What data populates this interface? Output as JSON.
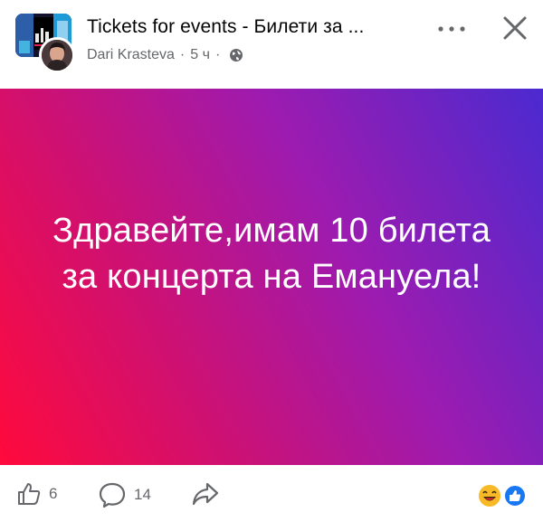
{
  "header": {
    "title": "Tickets for events - Билети за ...",
    "author": "Dari Krasteva",
    "separator": "·",
    "time": "5 ч",
    "privacy_icon": "globe-icon",
    "more_icon": "more-horizontal-icon",
    "close_icon": "close-icon"
  },
  "post": {
    "background": {
      "from": "#ff0a3c",
      "to": "#4b2ad0"
    },
    "text": "Здравейте,имам 10 билета за концерта на Емануела!"
  },
  "footer": {
    "like_icon": "thumbs-up-icon",
    "like_count": "6",
    "comment_icon": "comment-icon",
    "comment_count": "14",
    "share_icon": "share-icon",
    "reaction_icons": [
      "laughing-emoji-icon",
      "like-reaction-icon"
    ]
  },
  "colors": {
    "secondary_text": "#65676b",
    "like_blue": "#1877f2",
    "laugh_yellow": "#f7b928"
  }
}
